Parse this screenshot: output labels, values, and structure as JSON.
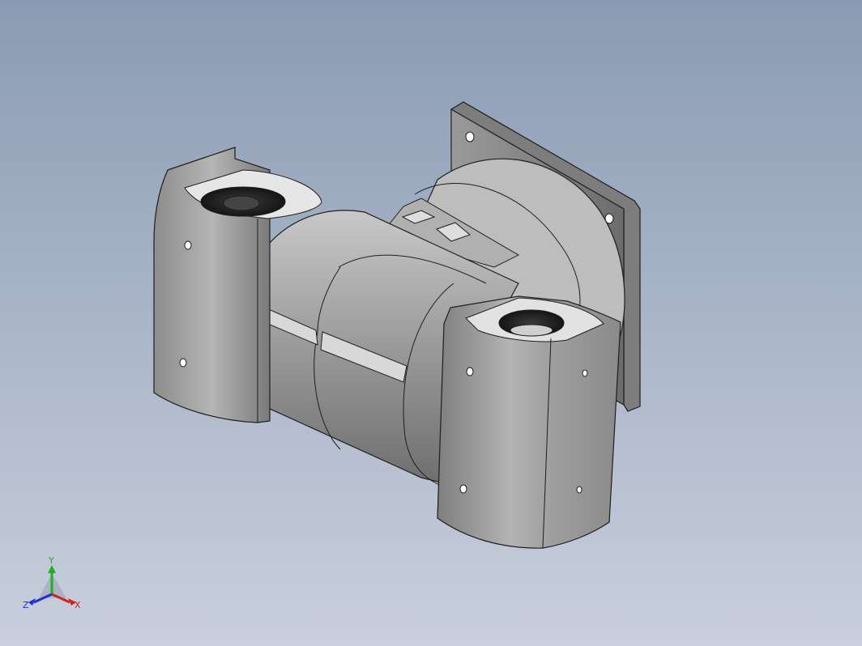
{
  "view": {
    "background_top": "#8a9bb3",
    "background_bottom": "#c9cfdc",
    "model_color": "#9a9a9a",
    "edge_color": "#1e1e1e"
  },
  "triad": {
    "x_label": "X",
    "y_label": "Y",
    "z_label": "Z",
    "x_color": "#d02020",
    "y_color": "#20b020",
    "z_color": "#2030d0"
  }
}
